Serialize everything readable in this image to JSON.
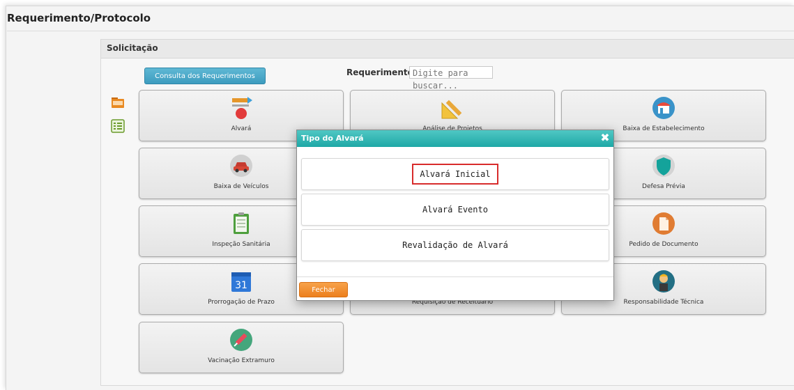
{
  "page": {
    "title": "Requerimento/Protocolo"
  },
  "panel": {
    "title": "Solicitação"
  },
  "toolbar": {
    "consulta_label": "Consulta dos Requerimentos"
  },
  "search": {
    "label": "Requerimento",
    "placeholder": "Digite para buscar..."
  },
  "side_icons": [
    "folder-icon",
    "checklist-icon"
  ],
  "tiles": [
    {
      "label": "Alvará",
      "icon": "stamp-icon"
    },
    {
      "label": "Análise de Projetos",
      "icon": "ruler-pencil-icon"
    },
    {
      "label": "Baixa de Estabelecimento",
      "icon": "storefront-icon"
    },
    {
      "label": "Baixa de Veículos",
      "icon": "car-icon"
    },
    {
      "label": "Defesa Prévia",
      "icon": "shield-icon"
    },
    {
      "label": "Inspeção Sanitária",
      "icon": "clipboard-icon"
    },
    {
      "label": "Pedido de Documento",
      "icon": "document-icon"
    },
    {
      "label": "Prorrogação de Prazo",
      "icon": "calendar-icon"
    },
    {
      "label": "Requisição de Receituário",
      "icon": "prescription-icon"
    },
    {
      "label": "Responsabilidade Técnica",
      "icon": "technician-icon"
    },
    {
      "label": "Vacinação Extramuro",
      "icon": "syringe-icon"
    }
  ],
  "calendar_day": "31",
  "modal": {
    "title": "Tipo do Alvará",
    "close_icon": "close-icon",
    "options": [
      {
        "label": "Alvará Inicial",
        "highlighted": true
      },
      {
        "label": "Alvará Evento",
        "highlighted": false
      },
      {
        "label": "Revalidação de Alvará",
        "highlighted": false
      }
    ],
    "close_label": "Fechar"
  },
  "colors": {
    "modal_header": "#1ea8a6",
    "consulta_button": "#3d9cbf",
    "fechar_button": "#ec7f1d",
    "highlight_border": "#d82b2b"
  }
}
